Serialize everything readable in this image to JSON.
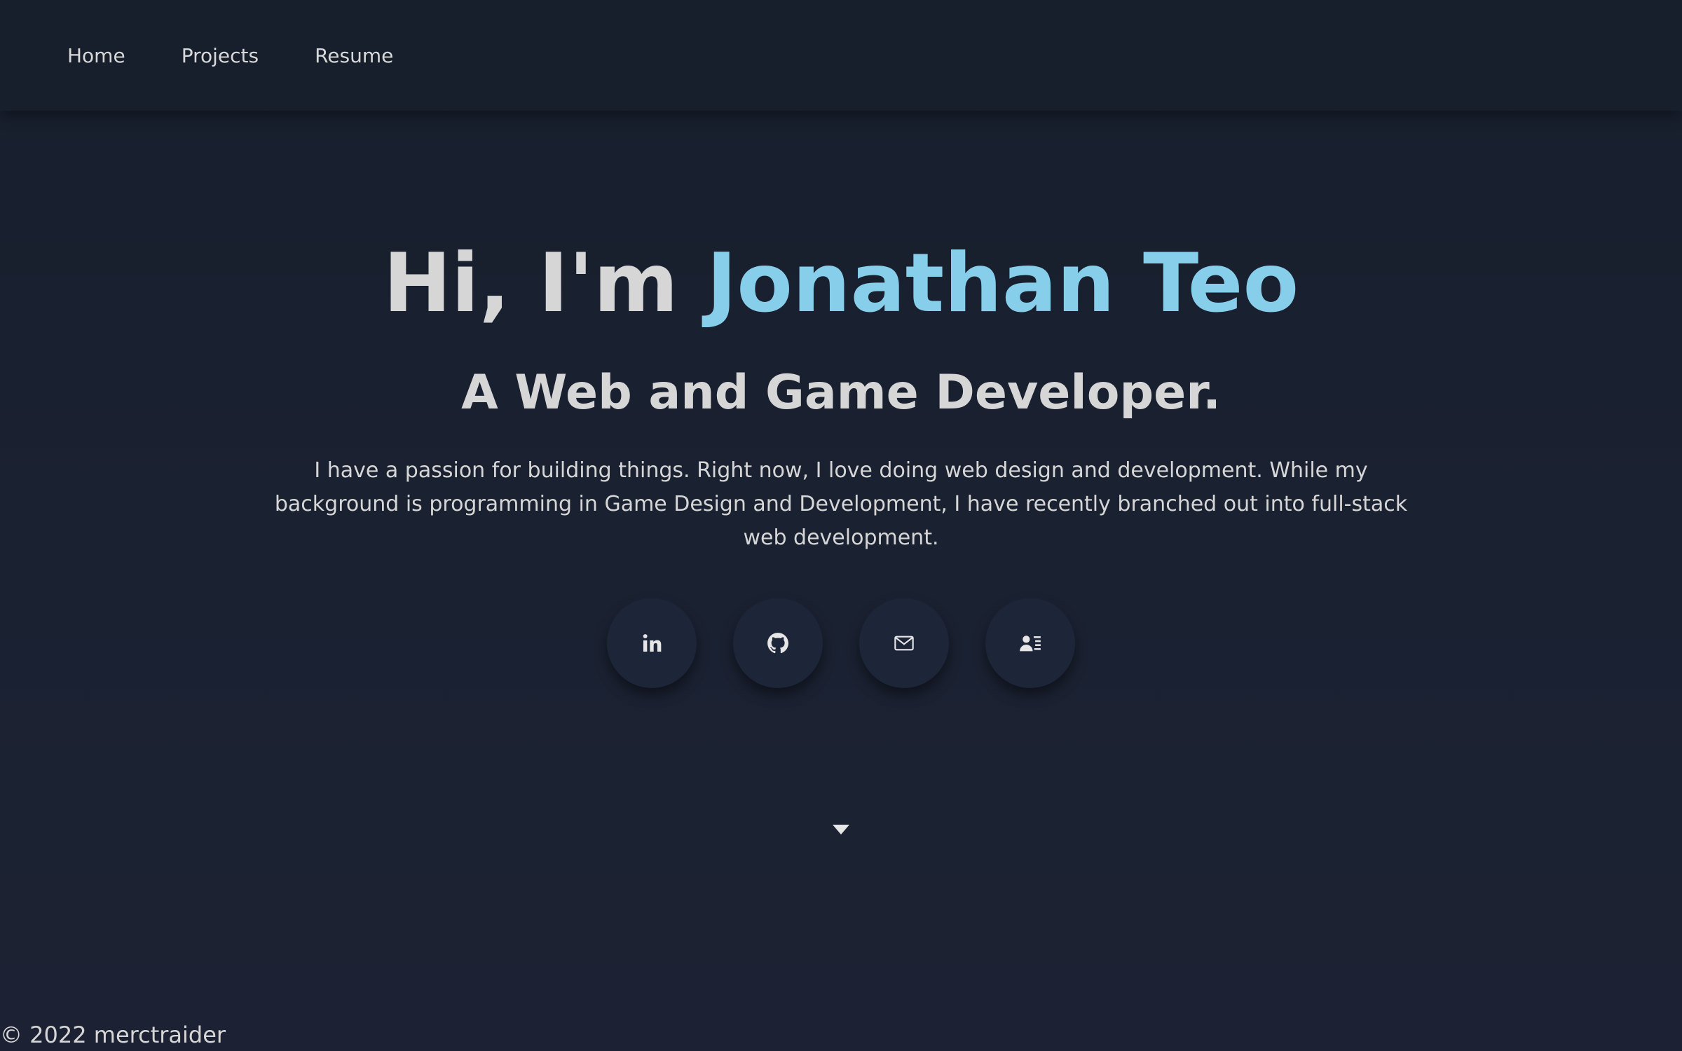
{
  "nav": {
    "items": [
      {
        "label": "Home"
      },
      {
        "label": "Projects"
      },
      {
        "label": "Resume"
      }
    ]
  },
  "hero": {
    "greeting": "Hi, I'm ",
    "name": "Jonathan Teo",
    "subtitle": "A Web and Game Developer.",
    "description": "I have a passion for building things. Right now, I love doing web design and development. While my background is programming in Game Design and Development, I have recently branched out into full-stack web development."
  },
  "socials": [
    {
      "icon": "linkedin-icon"
    },
    {
      "icon": "github-icon"
    },
    {
      "icon": "mail-icon"
    },
    {
      "icon": "contact-card-icon"
    }
  ],
  "scroll": {
    "icon": "caret-down-icon"
  },
  "footer": {
    "copyright": "© 2022 merctraider"
  },
  "colors": {
    "background": "#1a2131",
    "navbar": "#171e2c",
    "accent": "#87ceeb",
    "text": "#d6d6d6",
    "button": "#1c2638"
  }
}
